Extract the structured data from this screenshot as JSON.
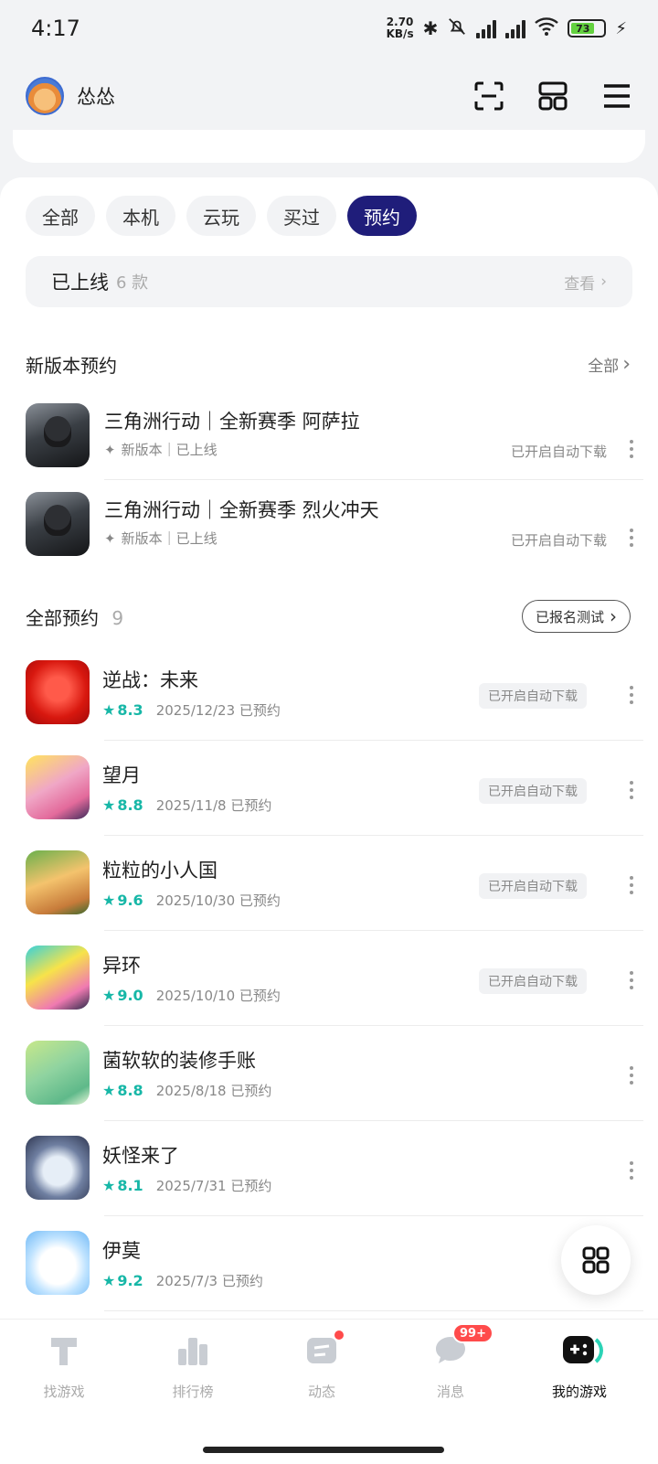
{
  "status": {
    "time": "4:17",
    "netspeed_value": "2.70",
    "netspeed_unit": "KB/s",
    "battery": "73"
  },
  "header": {
    "username": "怂怂"
  },
  "filters": [
    {
      "label": "全部"
    },
    {
      "label": "本机"
    },
    {
      "label": "云玩"
    },
    {
      "label": "买过"
    },
    {
      "label": "预约"
    }
  ],
  "online": {
    "label": "已上线",
    "count": "6 款",
    "view": "查看"
  },
  "new_version": {
    "title": "新版本预约",
    "more": "全部",
    "items": [
      {
        "title": "三角洲行动｜全新赛季 阿萨拉",
        "sub": "新版本｜已上线",
        "status": "已开启自动下载"
      },
      {
        "title": "三角洲行动｜全新赛季 烈火冲天",
        "sub": "新版本｜已上线",
        "status": "已开启自动下载"
      }
    ]
  },
  "reservations": {
    "title": "全部预约",
    "count": "9",
    "test_button": "已报名测试",
    "items": [
      {
        "name": "逆战：未来",
        "score": "8.3",
        "date": "2025/12/23 已预约",
        "status": "已开启自动下载"
      },
      {
        "name": "望月",
        "score": "8.8",
        "date": "2025/11/8 已预约",
        "status": "已开启自动下载"
      },
      {
        "name": "粒粒的小人国",
        "score": "9.6",
        "date": "2025/10/30 已预约",
        "status": "已开启自动下载"
      },
      {
        "name": "异环",
        "score": "9.0",
        "date": "2025/10/10 已预约",
        "status": "已开启自动下载"
      },
      {
        "name": "菌软软的装修手账",
        "score": "8.8",
        "date": "2025/8/18 已预约",
        "status": ""
      },
      {
        "name": "妖怪来了",
        "score": "8.1",
        "date": "2025/7/31 已预约",
        "status": ""
      },
      {
        "name": "伊莫",
        "score": "9.2",
        "date": "2025/7/3 已预约",
        "status": ""
      }
    ]
  },
  "tabbar": {
    "tabs": [
      {
        "label": "找游戏"
      },
      {
        "label": "排行榜"
      },
      {
        "label": "动态"
      },
      {
        "label": "消息",
        "badge": "99+"
      },
      {
        "label": "我的游戏"
      }
    ]
  },
  "colors": {
    "accent": "#1f1d7a",
    "score": "#17b7a7",
    "badge": "#ff4b4b"
  }
}
